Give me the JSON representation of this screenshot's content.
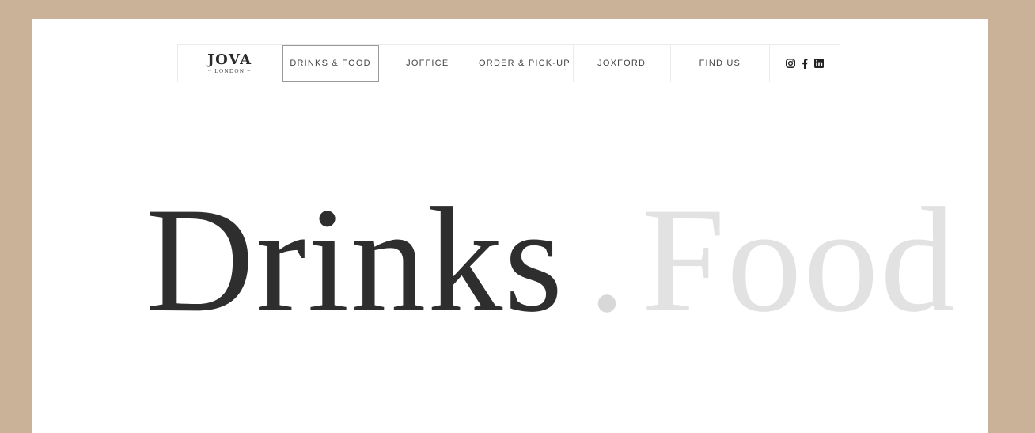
{
  "brand": {
    "name": "JOVA",
    "sub": "~ LONDON ~"
  },
  "nav": {
    "items": [
      {
        "label": "DRINKS & FOOD",
        "active": true
      },
      {
        "label": "JOFFICE"
      },
      {
        "label": "ORDER & PICK-UP"
      },
      {
        "label": "JOXFORD"
      },
      {
        "label": "FIND US"
      }
    ],
    "social": [
      "instagram-icon",
      "facebook-icon",
      "linkedin-icon"
    ]
  },
  "hero": {
    "word_1": "Drinks",
    "separator": ".",
    "word_2": "Food"
  },
  "colors": {
    "frame": "#c9b298",
    "page": "#ffffff",
    "hero_primary": "#2e2e2e",
    "hero_faded": "#e2e2e2"
  }
}
